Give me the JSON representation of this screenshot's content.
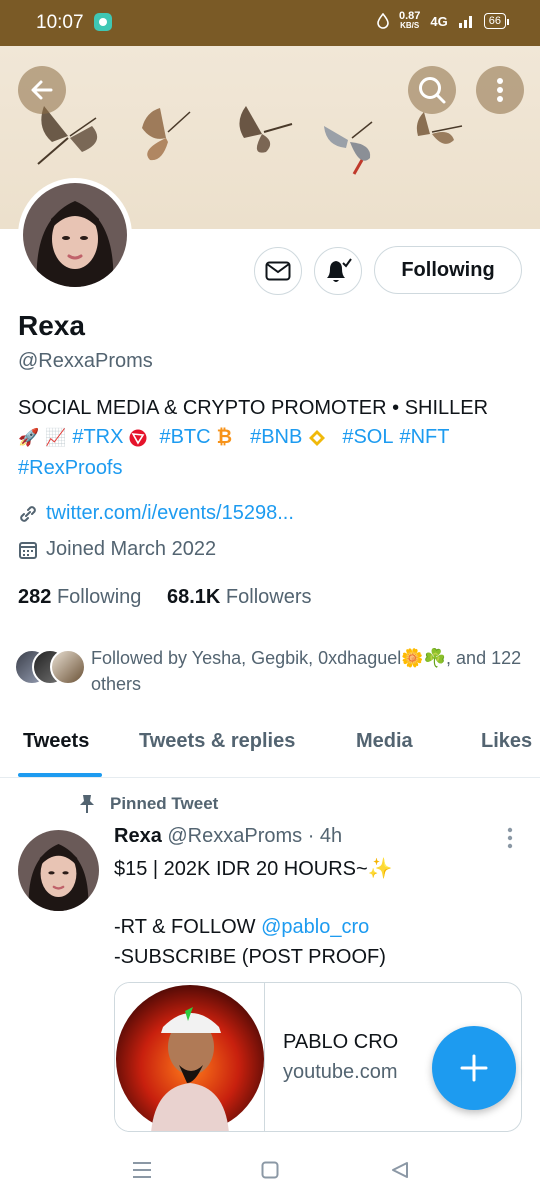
{
  "status_bar": {
    "time": "10:07",
    "net_speed": "0.87",
    "net_unit": "KB/S",
    "network": "4G",
    "battery": "66"
  },
  "profile": {
    "name": "Rexa",
    "handle": "@RexxaProms",
    "follow_button": "Following",
    "bio": {
      "line1": "SOCIAL MEDIA & CRYPTO PROMOTER • SHILLER",
      "tags": [
        "#TRX",
        "#BTC",
        "#BNB",
        "#SOL",
        "#NFT"
      ],
      "line3": "#RexProofs"
    },
    "link": "twitter.com/i/events/15298...",
    "joined": "Joined March 2022",
    "following_count": "282",
    "following_label": "Following",
    "followers_count": "68.1K",
    "followers_label": "Followers",
    "followed_by": "Followed by Yesha, Gegbik, 0xdhaguel🌼☘️, and 122 others"
  },
  "tabs": [
    "Tweets",
    "Tweets & replies",
    "Media",
    "Likes"
  ],
  "tweet": {
    "pinned_label": "Pinned Tweet",
    "author": "Rexa",
    "handle": "@RexxaProms",
    "time": "· 4h",
    "line1": "$15 | 202K IDR 20 HOURS~✨",
    "line2_prefix": "-RT & FOLLOW",
    "mention": "@pablo_cro",
    "line3": "-SUBSCRIBE (POST PROOF)",
    "card_title": "PABLO CRO",
    "card_domain": "youtube.com"
  },
  "icons": {
    "back": "back-arrow-icon",
    "search": "search-icon",
    "more": "more-vertical-icon",
    "mail": "mail-icon",
    "bell": "bell-subscribed-icon",
    "link": "link-icon",
    "calendar": "calendar-icon",
    "pin": "pin-icon",
    "compose": "plus-icon"
  },
  "colors": {
    "accent": "#1d9bf0",
    "statusbar": "#7a5a26",
    "text": "#0f1419",
    "muted": "#536471"
  }
}
